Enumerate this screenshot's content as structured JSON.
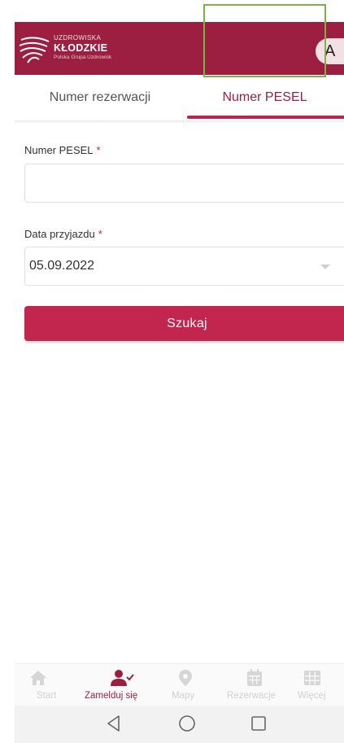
{
  "header": {
    "logo_small": "UZDROWISKA",
    "logo_big": "KŁODZKIE",
    "logo_sub": "Polska Grupa Uzdrowisk",
    "avatar_letter": "A"
  },
  "tabs": [
    {
      "label": "Numer rezerwacji",
      "active": false
    },
    {
      "label": "Numer PESEL",
      "active": true
    }
  ],
  "form": {
    "pesel": {
      "label": "Numer PESEL",
      "required_mark": "*",
      "value": ""
    },
    "date": {
      "label": "Data przyjazdu",
      "required_mark": "*",
      "value": "05.09.2022"
    },
    "submit_label": "Szukaj"
  },
  "bottom_nav": [
    {
      "label": "Start",
      "icon": "home-icon",
      "active": false
    },
    {
      "label": "Zamelduj się",
      "icon": "user-check-icon",
      "active": true
    },
    {
      "label": "Mapy",
      "icon": "map-pin-icon",
      "active": false
    },
    {
      "label": "Rezerwacje",
      "icon": "calendar-icon",
      "active": false
    },
    {
      "label": "Więcej",
      "icon": "grid-icon",
      "active": false
    }
  ],
  "system_nav": [
    "back-icon",
    "home-circle-icon",
    "recents-icon"
  ],
  "colors": {
    "brand": "#9c1f41",
    "button": "#c2264f",
    "required": "#c2243f",
    "inactive_nav": "#d0d0d0"
  }
}
